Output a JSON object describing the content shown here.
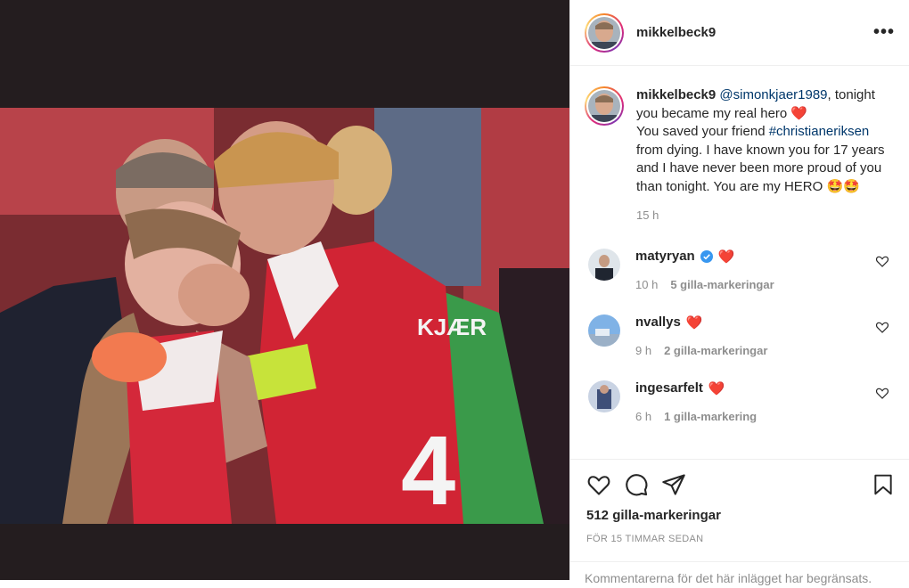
{
  "post": {
    "username": "mikkelbeck9",
    "more_label": "•••"
  },
  "caption": {
    "username": "mikkelbeck9",
    "mention": "@simonkjaer1989",
    "text_1": ",",
    "text_2": "tonight you became my real hero",
    "text_3": "You saved your friend",
    "hashtag": "#christianeriksen",
    "text_4": "from dying. I have known you for 17 years and I have never been more proud of you than tonight. You are my HERO",
    "emoji": "🤩🤩",
    "time": "15 h"
  },
  "comments": [
    {
      "username": "matyryan",
      "verified": true,
      "heart_emoji": "❤️",
      "time": "10 h",
      "likes": "5 gilla-markeringar",
      "avatar_color": "#6d7b86"
    },
    {
      "username": "nvallys",
      "verified": false,
      "heart_emoji": "❤️",
      "time": "9 h",
      "likes": "2 gilla-markeringar",
      "avatar_color": "#6c9fd6"
    },
    {
      "username": "ingesarfelt",
      "verified": false,
      "heart_emoji": "❤️",
      "time": "6 h",
      "likes": "1 gilla-markering",
      "avatar_color": "#5a6e93"
    }
  ],
  "actions": {
    "likes_count": "512 gilla-markeringar",
    "timestamp": "FÖR 15 TIMMAR SEDAN",
    "add_comment_notice": "Kommentarerna för det här inlägget har begränsats."
  },
  "colors": {
    "link": "#00376b",
    "muted": "#8e8e8e",
    "text": "#262626",
    "heart_red": "#ed4956",
    "verified_blue": "#3897f0"
  }
}
